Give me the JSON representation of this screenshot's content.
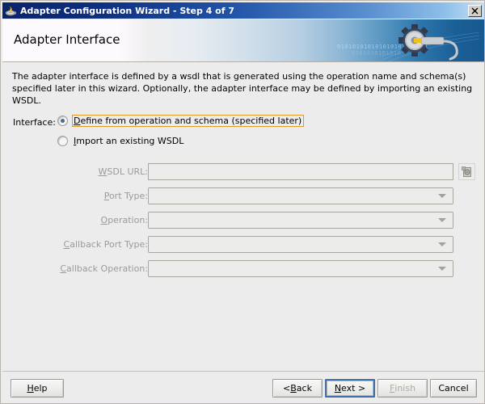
{
  "window": {
    "title": "Adapter Configuration Wizard - Step 4 of 7",
    "app_icon": "coffee-cup-icon",
    "close_label": "✕"
  },
  "banner": {
    "heading": "Adapter Interface",
    "decor_icon": "gear-with-cable-icon",
    "binary_line1": "010101010101010101010101",
    "binary_line2": "0101010101010"
  },
  "content": {
    "description": "The adapter interface is defined by a wsdl that is generated using the operation name and schema(s) specified later in this wizard.  Optionally, the adapter interface may be defined by importing an existing WSDL.",
    "interface_label": "Interface:",
    "radios": [
      {
        "label_before": "D",
        "mnemonic": "",
        "label_full": "Define from operation and schema (specified later)",
        "label_rest": "efine from operation and schema (specified later)",
        "selected": true,
        "focused": true
      },
      {
        "label_before": "I",
        "label_full": "Import an existing WSDL",
        "label_rest": "mport an existing WSDL",
        "selected": false,
        "focused": false
      }
    ],
    "fields": [
      {
        "label_mnemonic": "W",
        "label_rest": "SDL URL:",
        "type": "text",
        "value": "",
        "placeholder": "",
        "disabled": true,
        "browse_icon": "browse-document-icon"
      },
      {
        "label_mnemonic": "P",
        "label_rest": "ort Type:",
        "type": "combo",
        "value": "",
        "disabled": true
      },
      {
        "label_mnemonic": "O",
        "label_rest": "peration:",
        "type": "combo",
        "value": "",
        "disabled": true
      },
      {
        "label_mnemonic": "C",
        "label_rest": "allback Port Type:",
        "type": "combo",
        "value": "",
        "disabled": true
      },
      {
        "label_mnemonic": "C",
        "label_rest": "allback Operation:",
        "type": "combo",
        "value": "",
        "disabled": true
      }
    ]
  },
  "buttons": {
    "help": {
      "mnemonic": "H",
      "rest": "elp",
      "disabled": false,
      "default": false
    },
    "back": {
      "prefix": "< ",
      "mnemonic": "B",
      "rest": "ack",
      "disabled": false,
      "default": false
    },
    "next": {
      "mnemonic": "N",
      "rest": "ext >",
      "disabled": false,
      "default": true
    },
    "finish": {
      "mnemonic": "F",
      "rest": "inish",
      "disabled": true,
      "default": false
    },
    "cancel": {
      "mnemonic": "",
      "rest": "Cancel",
      "disabled": false,
      "default": false
    }
  },
  "colors": {
    "titlebar_start": "#0a246a",
    "titlebar_end": "#c8dff5",
    "panel_bg": "#ececec",
    "focus_outline": "#e09a27",
    "default_button_border": "#3f6fa8",
    "disabled_text": "#9a9a96"
  }
}
